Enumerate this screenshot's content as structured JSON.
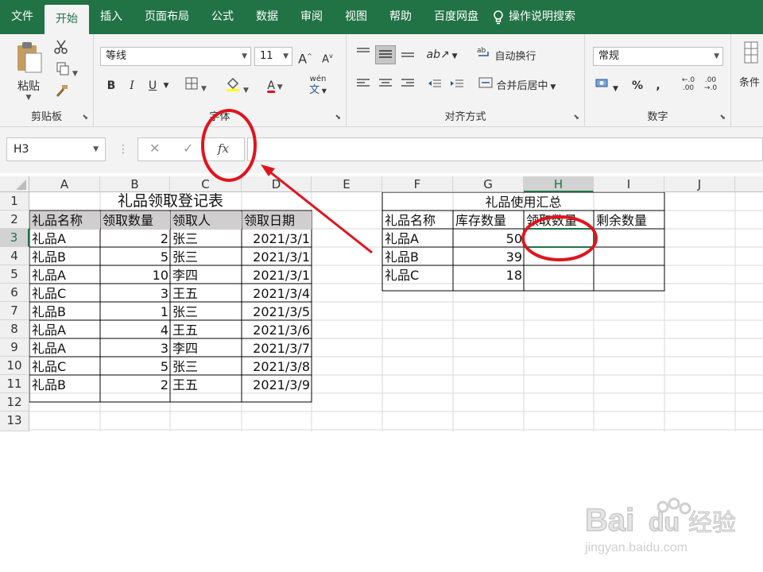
{
  "menu": {
    "tabs": [
      "文件",
      "开始",
      "插入",
      "页面布局",
      "公式",
      "数据",
      "审阅",
      "视图",
      "帮助",
      "百度网盘"
    ],
    "active_tab": "开始",
    "search": "操作说明搜索"
  },
  "ribbon": {
    "clipboard": {
      "paste": "粘贴",
      "label": "剪贴板"
    },
    "font": {
      "name": "等线",
      "size": "11",
      "bold": "B",
      "italic": "I",
      "underline": "U",
      "phonetic": "wén",
      "label": "字体"
    },
    "alignment": {
      "wrap": "自动换行",
      "merge": "合并后居中",
      "label": "对齐方式"
    },
    "number": {
      "format": "常规",
      "percent": "%",
      "comma": ",",
      "label": "数字"
    },
    "styles": {
      "conditional": "条件"
    }
  },
  "formula_bar": {
    "name_box": "H3",
    "cancel": "✕",
    "enter": "✓",
    "fx": "fx",
    "value": ""
  },
  "sheet": {
    "columns": [
      "A",
      "B",
      "C",
      "D",
      "E",
      "F",
      "G",
      "H",
      "I",
      "J"
    ],
    "selected_column": "H",
    "rows": [
      "1",
      "2",
      "3",
      "4",
      "5",
      "6",
      "7",
      "8",
      "9",
      "10",
      "11",
      "12",
      "13"
    ],
    "selected_row": "3",
    "table1": {
      "title": "礼品领取登记表",
      "headers": [
        "礼品名称",
        "领取数量",
        "领取人",
        "领取日期"
      ],
      "rows": [
        [
          "礼品A",
          "2",
          "张三",
          "2021/3/1"
        ],
        [
          "礼品B",
          "5",
          "张三",
          "2021/3/1"
        ],
        [
          "礼品A",
          "10",
          "李四",
          "2021/3/1"
        ],
        [
          "礼品C",
          "3",
          "王五",
          "2021/3/4"
        ],
        [
          "礼品B",
          "1",
          "张三",
          "2021/3/5"
        ],
        [
          "礼品A",
          "4",
          "王五",
          "2021/3/6"
        ],
        [
          "礼品A",
          "3",
          "李四",
          "2021/3/7"
        ],
        [
          "礼品C",
          "5",
          "张三",
          "2021/3/8"
        ],
        [
          "礼品B",
          "2",
          "王五",
          "2021/3/9"
        ]
      ]
    },
    "table2": {
      "title": "礼品使用汇总",
      "headers": [
        "礼品名称",
        "库存数量",
        "领取数量",
        "剩余数量"
      ],
      "rows": [
        [
          "礼品A",
          "50",
          "",
          ""
        ],
        [
          "礼品B",
          "39",
          "",
          ""
        ],
        [
          "礼品C",
          "18",
          "",
          ""
        ]
      ]
    }
  },
  "annotation_color": "#e0141e",
  "accent": "#217346"
}
